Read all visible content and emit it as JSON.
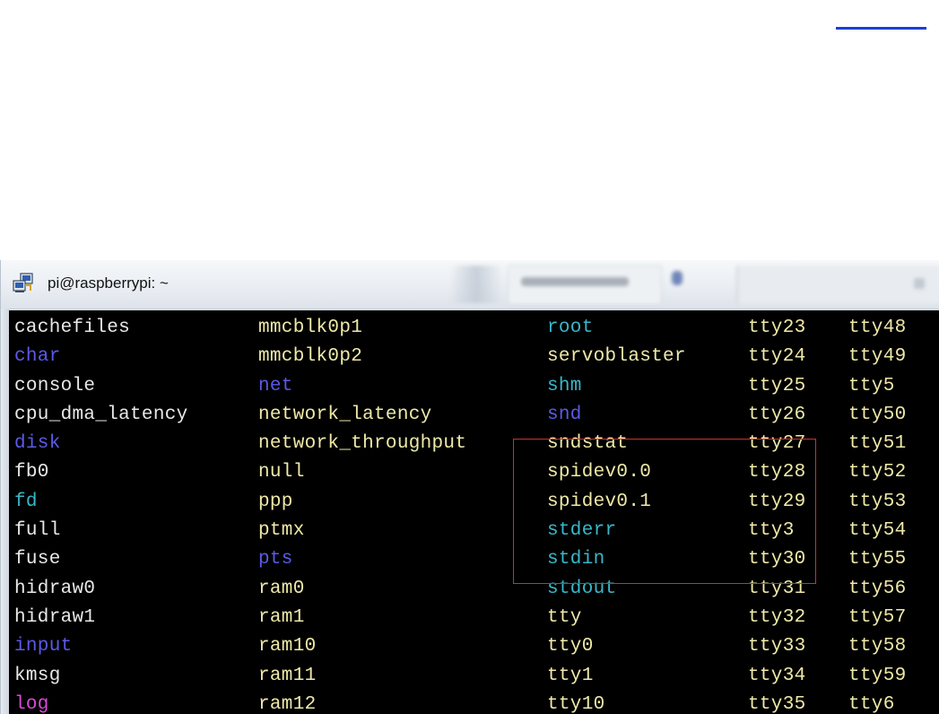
{
  "window": {
    "title": "pi@raspberrypi: ~",
    "icon": "putty-icon"
  },
  "colors": {
    "white": "#e8e8e8",
    "dir_blue": "#5a5ae6",
    "link_cyan": "#3ab6c9",
    "exec_yellow": "#e8e08a",
    "magenta": "#d84ad8",
    "pale_yellow": "#efe9a8",
    "highlight": "#c8322f"
  },
  "terminal": {
    "rows": [
      [
        {
          "t": "cachefiles",
          "c": "white"
        },
        {
          "t": "mmcblk0p1",
          "c": "pale_yellow"
        },
        {
          "t": "root",
          "c": "link_cyan"
        },
        {
          "t": "tty23",
          "c": "pale_yellow"
        },
        {
          "t": "tty48",
          "c": "pale_yellow"
        }
      ],
      [
        {
          "t": "char",
          "c": "dir_blue"
        },
        {
          "t": "mmcblk0p2",
          "c": "pale_yellow"
        },
        {
          "t": "servoblaster",
          "c": "pale_yellow"
        },
        {
          "t": "tty24",
          "c": "pale_yellow"
        },
        {
          "t": "tty49",
          "c": "pale_yellow"
        }
      ],
      [
        {
          "t": "console",
          "c": "white"
        },
        {
          "t": "net",
          "c": "dir_blue"
        },
        {
          "t": "shm",
          "c": "link_cyan"
        },
        {
          "t": "tty25",
          "c": "pale_yellow"
        },
        {
          "t": "tty5",
          "c": "pale_yellow"
        }
      ],
      [
        {
          "t": "cpu_dma_latency",
          "c": "white"
        },
        {
          "t": "network_latency",
          "c": "pale_yellow"
        },
        {
          "t": "snd",
          "c": "dir_blue"
        },
        {
          "t": "tty26",
          "c": "pale_yellow"
        },
        {
          "t": "tty50",
          "c": "pale_yellow"
        }
      ],
      [
        {
          "t": "disk",
          "c": "dir_blue"
        },
        {
          "t": "network_throughput",
          "c": "pale_yellow"
        },
        {
          "t": "sndstat",
          "c": "pale_yellow"
        },
        {
          "t": "tty27",
          "c": "pale_yellow"
        },
        {
          "t": "tty51",
          "c": "pale_yellow"
        }
      ],
      [
        {
          "t": "fb0",
          "c": "white"
        },
        {
          "t": "null",
          "c": "pale_yellow"
        },
        {
          "t": "spidev0.0",
          "c": "pale_yellow"
        },
        {
          "t": "tty28",
          "c": "pale_yellow"
        },
        {
          "t": "tty52",
          "c": "pale_yellow"
        }
      ],
      [
        {
          "t": "fd",
          "c": "link_cyan"
        },
        {
          "t": "ppp",
          "c": "pale_yellow"
        },
        {
          "t": "spidev0.1",
          "c": "pale_yellow"
        },
        {
          "t": "tty29",
          "c": "pale_yellow"
        },
        {
          "t": "tty53",
          "c": "pale_yellow"
        }
      ],
      [
        {
          "t": "full",
          "c": "white"
        },
        {
          "t": "ptmx",
          "c": "pale_yellow"
        },
        {
          "t": "stderr",
          "c": "link_cyan"
        },
        {
          "t": "tty3",
          "c": "pale_yellow"
        },
        {
          "t": "tty54",
          "c": "pale_yellow"
        }
      ],
      [
        {
          "t": "fuse",
          "c": "white"
        },
        {
          "t": "pts",
          "c": "dir_blue"
        },
        {
          "t": "stdin",
          "c": "link_cyan"
        },
        {
          "t": "tty30",
          "c": "pale_yellow"
        },
        {
          "t": "tty55",
          "c": "pale_yellow"
        }
      ],
      [
        {
          "t": "hidraw0",
          "c": "white"
        },
        {
          "t": "ram0",
          "c": "pale_yellow"
        },
        {
          "t": "stdout",
          "c": "link_cyan"
        },
        {
          "t": "tty31",
          "c": "pale_yellow"
        },
        {
          "t": "tty56",
          "c": "pale_yellow"
        }
      ],
      [
        {
          "t": "hidraw1",
          "c": "white"
        },
        {
          "t": "ram1",
          "c": "pale_yellow"
        },
        {
          "t": "tty",
          "c": "pale_yellow"
        },
        {
          "t": "tty32",
          "c": "pale_yellow"
        },
        {
          "t": "tty57",
          "c": "pale_yellow"
        }
      ],
      [
        {
          "t": "input",
          "c": "dir_blue"
        },
        {
          "t": "ram10",
          "c": "pale_yellow"
        },
        {
          "t": "tty0",
          "c": "pale_yellow"
        },
        {
          "t": "tty33",
          "c": "pale_yellow"
        },
        {
          "t": "tty58",
          "c": "pale_yellow"
        }
      ],
      [
        {
          "t": "kmsg",
          "c": "white"
        },
        {
          "t": "ram11",
          "c": "pale_yellow"
        },
        {
          "t": "tty1",
          "c": "pale_yellow"
        },
        {
          "t": "tty34",
          "c": "pale_yellow"
        },
        {
          "t": "tty59",
          "c": "pale_yellow"
        }
      ],
      [
        {
          "t": "log",
          "c": "magenta"
        },
        {
          "t": "ram12",
          "c": "pale_yellow"
        },
        {
          "t": "tty10",
          "c": "pale_yellow"
        },
        {
          "t": "tty35",
          "c": "pale_yellow"
        },
        {
          "t": "tty6",
          "c": "pale_yellow"
        }
      ]
    ]
  }
}
